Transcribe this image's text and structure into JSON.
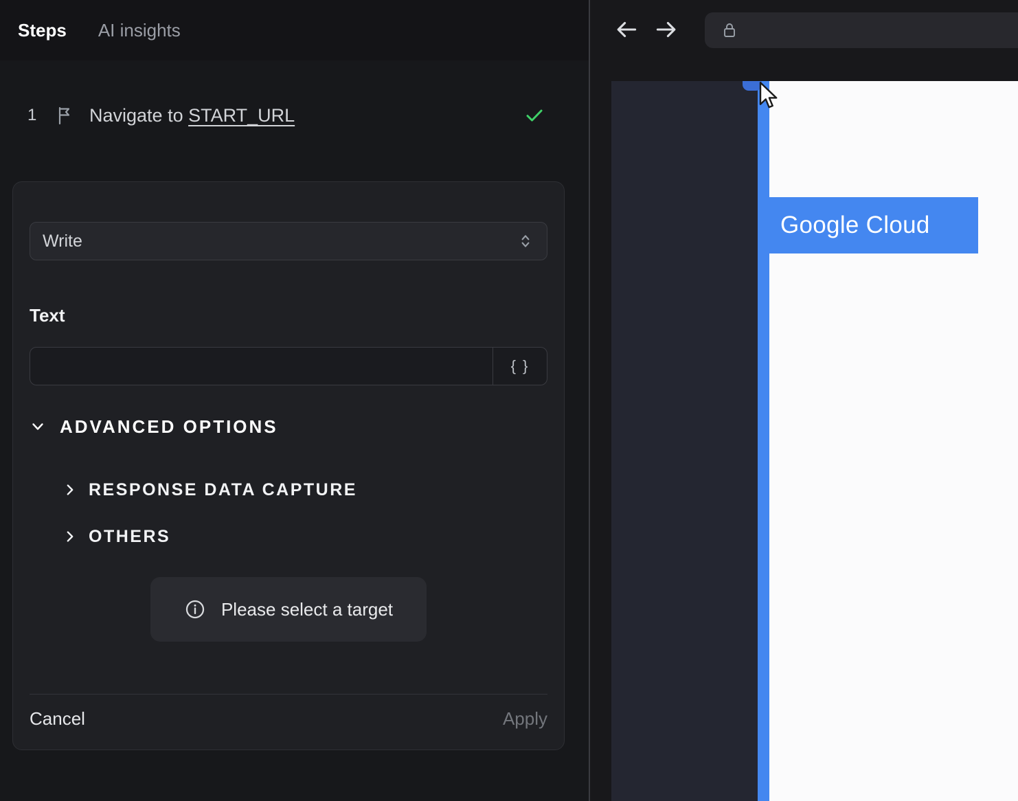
{
  "left_panel": {
    "tabs": [
      {
        "label": "Steps",
        "active": true
      },
      {
        "label": "AI insights",
        "active": false
      }
    ],
    "step": {
      "number": "1",
      "icon": "flag-icon",
      "text": "Navigate to ",
      "link_text": "START_URL",
      "status_icon": "check-icon",
      "status": "success"
    },
    "editor": {
      "action_select": {
        "value": "Write",
        "icon": "chevron-updown-icon"
      },
      "text_field": {
        "label": "Text",
        "value": "",
        "variables_button": "{ }"
      },
      "advanced_options": {
        "label": "ADVANCED OPTIONS",
        "icon": "chevron-down-icon",
        "expanded": true
      },
      "sections": [
        {
          "label": "RESPONSE DATA CAPTURE",
          "icon": "chevron-right-icon"
        },
        {
          "label": "OTHERS",
          "icon": "chevron-right-icon"
        }
      ],
      "hint": {
        "icon": "info-icon",
        "text": "Please select a target"
      },
      "footer": {
        "cancel": "Cancel",
        "apply": "Apply",
        "apply_enabled": false
      }
    }
  },
  "browser": {
    "toolbar": {
      "back_icon": "arrow-left-icon",
      "forward_icon": "arrow-right-icon",
      "address_bar": {
        "icon": "lock-icon",
        "value": ""
      }
    },
    "page": {
      "highlight_label": "Google Cloud"
    }
  },
  "colors": {
    "accent_blue": "#4487f0",
    "success_green": "#3fd068"
  }
}
